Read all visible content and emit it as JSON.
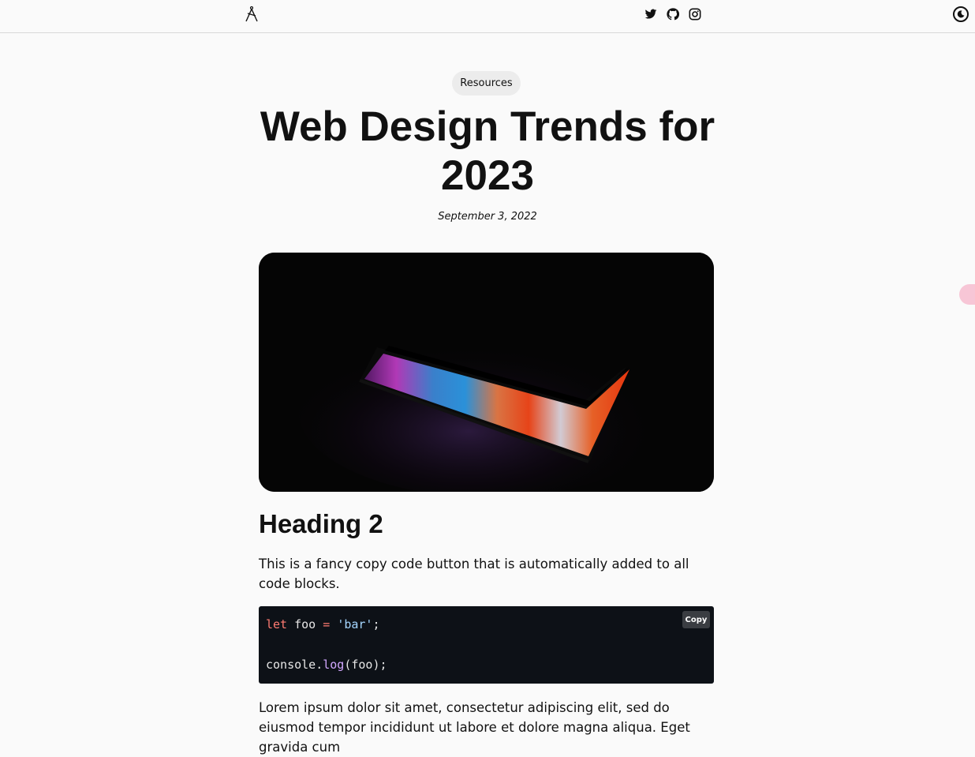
{
  "header": {
    "logo_icon": "compass-x-logo-icon",
    "social": [
      {
        "name": "twitter",
        "icon": "twitter-icon"
      },
      {
        "name": "github",
        "icon": "github-icon"
      },
      {
        "name": "instagram",
        "icon": "instagram-icon"
      }
    ],
    "theme_toggle_icon": "moon-icon"
  },
  "article": {
    "category": "Resources",
    "title_line1": "Web Design Trends for",
    "title_line2": "2023",
    "date": "September 3, 2022",
    "hero_image": "laptop-rainbow-glow-image",
    "heading2": "Heading 2",
    "paragraph1": "This is a fancy copy code button that is automatically added to all code blocks.",
    "code": {
      "copy_label": "Copy",
      "line1": {
        "kw": "let",
        "ident": " foo ",
        "op": "=",
        "space": " ",
        "str": "'bar'",
        "end": ";"
      },
      "line2": {
        "obj": "console.",
        "fn": "log",
        "args": "(foo);"
      }
    },
    "paragraph2": "Lorem ipsum dolor sit amet, consectetur adipiscing elit, sed do eiusmod tempor incididunt ut labore et dolore magna aliqua. Eget gravida cum"
  },
  "colors": {
    "background": "#fafafa",
    "code_bg": "#0d1117",
    "keyword": "#ff7b72",
    "string": "#a5d6ff",
    "function": "#d2a8ff"
  }
}
